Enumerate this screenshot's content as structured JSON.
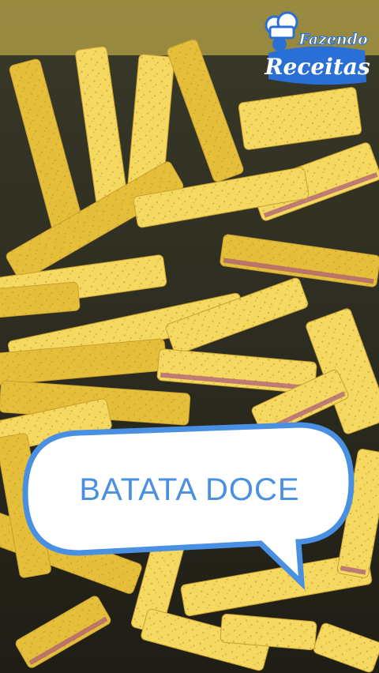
{
  "logo": {
    "line1": "Fazendo",
    "line2": "Receitas"
  },
  "caption": {
    "text": "BATATA DOCE"
  },
  "colors": {
    "fry": "#f4d860",
    "fry_dark": "#e6bf3a",
    "skin": "#a8557a",
    "bubble_border": "#4a90e2",
    "logo_blue": "#2a6fd6"
  }
}
